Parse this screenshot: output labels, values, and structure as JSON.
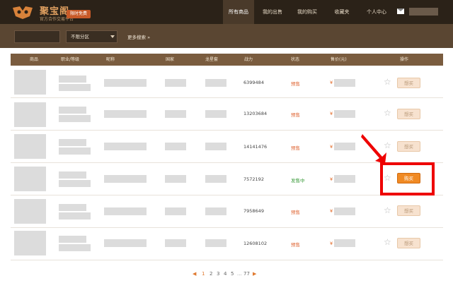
{
  "header": {
    "logo_title": "聚宝阁",
    "logo_subtitle": "官方合作交易平台",
    "badge": "限时免费",
    "nav": [
      {
        "label": "所有商品",
        "active": true
      },
      {
        "label": "我的出售",
        "active": false
      },
      {
        "label": "我的购买",
        "active": false
      },
      {
        "label": "收藏夹",
        "active": false
      },
      {
        "label": "个人中心",
        "active": false
      }
    ],
    "mail_icon": "mail-icon"
  },
  "search": {
    "keyword_value": "",
    "server_select": "不限分区",
    "more_search": "更多搜索 »"
  },
  "table": {
    "columns": [
      "商品",
      "职业/等级",
      "昵称",
      "国家",
      "龙星套",
      "战力",
      "状态",
      "售价(元)",
      "操作"
    ],
    "rows": [
      {
        "power": "6399484",
        "status": "预售",
        "status_color": "#e06a3a",
        "buy": "想买",
        "buy_active": false
      },
      {
        "power": "13203684",
        "status": "预售",
        "status_color": "#e06a3a",
        "buy": "想买",
        "buy_active": false
      },
      {
        "power": "14141476",
        "status": "预售",
        "status_color": "#e06a3a",
        "buy": "想买",
        "buy_active": false
      },
      {
        "power": "7572192",
        "status": "发售中",
        "status_color": "#3a9a3a",
        "buy": "购买",
        "buy_active": true
      },
      {
        "power": "7958649",
        "status": "预售",
        "status_color": "#e06a3a",
        "buy": "想买",
        "buy_active": false
      },
      {
        "power": "12608102",
        "status": "预售",
        "status_color": "#e06a3a",
        "buy": "想买",
        "buy_active": false
      }
    ],
    "yen_symbol": "¥",
    "star_icon": "star-outline-icon"
  },
  "pagination": {
    "pages": [
      "1",
      "2",
      "3",
      "4",
      "5",
      "...",
      "77"
    ],
    "current": "1"
  },
  "colors": {
    "header_bg": "#2b2218",
    "search_band_bg": "#5a4632",
    "table_head_bg": "#7a5c3f",
    "accent_orange": "#f08a24",
    "highlight_red": "#ee0000"
  }
}
